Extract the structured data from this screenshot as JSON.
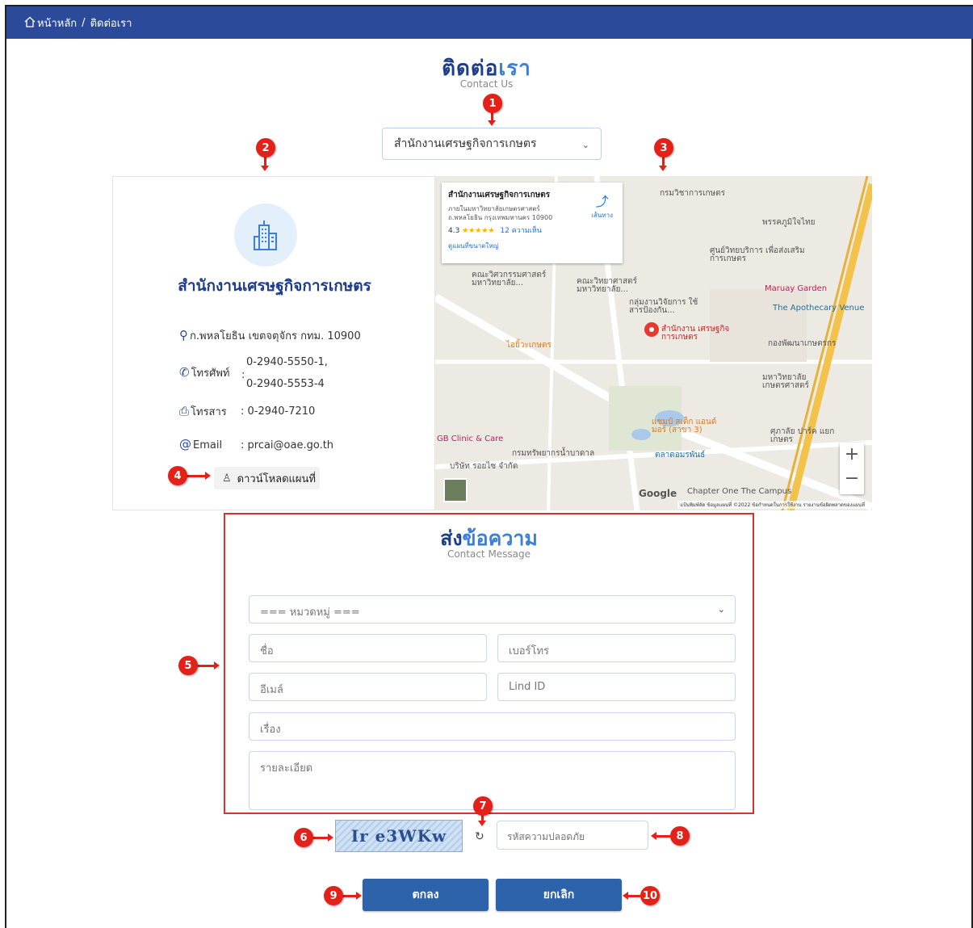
{
  "breadcrumb": {
    "home": "หน้าหลัก",
    "sep": "/",
    "current": "ติดต่อเรา"
  },
  "page": {
    "title_a": "ติดต่อ",
    "title_b": "เรา",
    "subtitle": "Contact Us"
  },
  "office_select": {
    "value": "สำนักงานเศรษฐกิจการเกษตร"
  },
  "callouts": [
    "1",
    "2",
    "3",
    "4",
    "5",
    "6",
    "7",
    "8",
    "9",
    "10"
  ],
  "office": {
    "name": "สำนักงานเศรษฐกิจการเกษตร",
    "address": "ก.พหลโยธิน เขตจตุจักร กทม. 10900",
    "phone_label": "โทรศัพท์",
    "phone_sep": ":",
    "phone_1": "0-2940-5550-1,",
    "phone_2": "0-2940-5553-4",
    "fax_label": "โทรสาร",
    "fax_value": ": 0-2940-7210",
    "email_label": "Email",
    "email_value": ": prcai@oae.go.th",
    "download_label": "ดาวน์โหลดแผนที่"
  },
  "map": {
    "card_title": "สำนักงานเศรษฐกิจการเกษตร",
    "card_addr_1": "ภายในมหาวิทยาลัยเกษตรศาสตร์",
    "card_addr_2": "ถ.พหลโยธิน กรุงเทพมหานคร 10900",
    "rating": "4.3",
    "stars": "★★★★★",
    "reviews": "12 ความเห็น",
    "larger_map": "ดูแผนที่ขนาดใหญ่",
    "directions": "เส้นทาง",
    "pin_label": "สำนักงาน เศรษฐกิจการเกษตร",
    "labels": [
      "กรมวิชาการเกษตร",
      "พรรคภูมิใจไทย",
      "ศูนย์วิทยบริการ เพื่อส่งเสริมการเกษตร",
      "Maruay Garden",
      "The Apothecary Venue",
      "กองพัฒนาเกษตรกร",
      "มหาวิทยาลัย เกษตรศาสตร์",
      "คณะวิศวกรรมศาสตร์ มหาวิทยาลัย...",
      "คณะวิทยาศาสตร์ มหาวิทยาลัย...",
      "กลุ่มงานวิจัยการ ใช้สารป้องกัน...",
      "ไอยิ้วะเกษตร",
      "GB Clinic & Care",
      "แชมป์ สเต็ก แอนด์ มอร์ (สาขา 3)",
      "ตลาดอมรพันธ์",
      "กรมทรัพยากรน้ำบาดาล",
      "บริษัท รอยไซ จำกัด",
      "ศุภาลัย ปาร์ค แยกเกษตร",
      "Chapter One The Campus"
    ],
    "google": "Google",
    "footer": "แป้นพิมพ์ลัด   ข้อมูลแผนที่ ©2022   ข้อกำหนดในการใช้งาน   รายงานข้อผิดพลาดของแผนที่",
    "zoom_in": "+",
    "zoom_out": "−"
  },
  "message": {
    "title_a": "ส่ง",
    "title_b": "ข้อความ",
    "subtitle": "Contact Message",
    "category_placeholder": "=== หมวดหมู่ ===",
    "name_placeholder": "ชื่อ",
    "phone_placeholder": "เบอร์โทร",
    "email_placeholder": "อีเมล์",
    "line_placeholder": "Lind ID",
    "subject_placeholder": "เรื่อง",
    "detail_placeholder": "รายละเอียด"
  },
  "captcha": {
    "text": "Ir e3WKw",
    "code_placeholder": "รหัสความปลอดภัย"
  },
  "buttons": {
    "ok": "ตกลง",
    "cancel": "ยกเลิก"
  }
}
